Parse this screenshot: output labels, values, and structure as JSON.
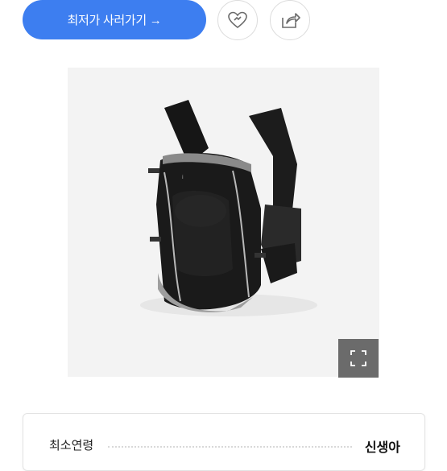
{
  "actions": {
    "cta_label": "최저가 사러가기 →"
  },
  "icons": {
    "like": "heart-icon",
    "share": "share-icon",
    "expand": "expand-icon"
  },
  "colors": {
    "accent": "#3d7ef0",
    "product_bg": "#f3f3f3"
  },
  "info": {
    "label": "최소연령",
    "value": "신생아"
  }
}
